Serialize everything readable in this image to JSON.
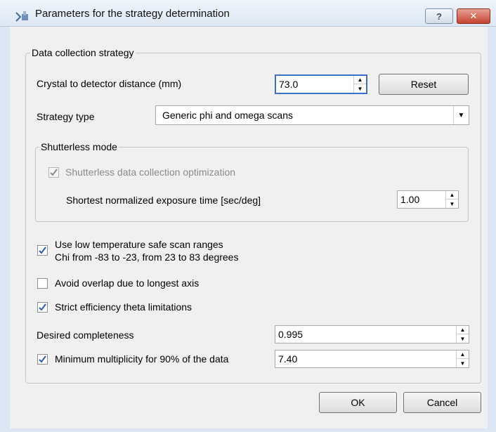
{
  "window": {
    "title": "Parameters for the strategy determination",
    "help_glyph": "?",
    "close_glyph": "✕"
  },
  "strategy_group": {
    "legend": "Data collection strategy",
    "distance_label": "Crystal to detector distance (mm)",
    "distance_value": "73.0",
    "reset_label": "Reset",
    "strategy_type_label": "Strategy type",
    "strategy_type_value": "Generic phi and omega scans"
  },
  "shutterless": {
    "legend": "Shutterless mode",
    "optimization_label": "Shutterless data collection optimization",
    "optimization_checked": true,
    "exposure_label": "Shortest normalized exposure time [sec/deg]",
    "exposure_value": "1.00"
  },
  "options": {
    "low_temp_line1": "Use low temperature safe scan ranges",
    "low_temp_line2": "Chi from -83 to -23, from 23 to 83 degrees",
    "low_temp_checked": true,
    "avoid_overlap_label": "Avoid overlap due to longest axis",
    "avoid_overlap_checked": false,
    "strict_efficiency_label": "Strict efficiency theta limitations",
    "strict_efficiency_checked": true,
    "completeness_label": "Desired completeness",
    "completeness_value": "0.995",
    "multiplicity_label": "Minimum multiplicity for 90% of the data",
    "multiplicity_checked": true,
    "multiplicity_value": "7.40"
  },
  "buttons": {
    "ok_label": "OK",
    "cancel_label": "Cancel"
  },
  "colors": {
    "check_accent": "#2a5db0",
    "focus_border": "#3b6fc9",
    "close_button": "#c4442f"
  }
}
